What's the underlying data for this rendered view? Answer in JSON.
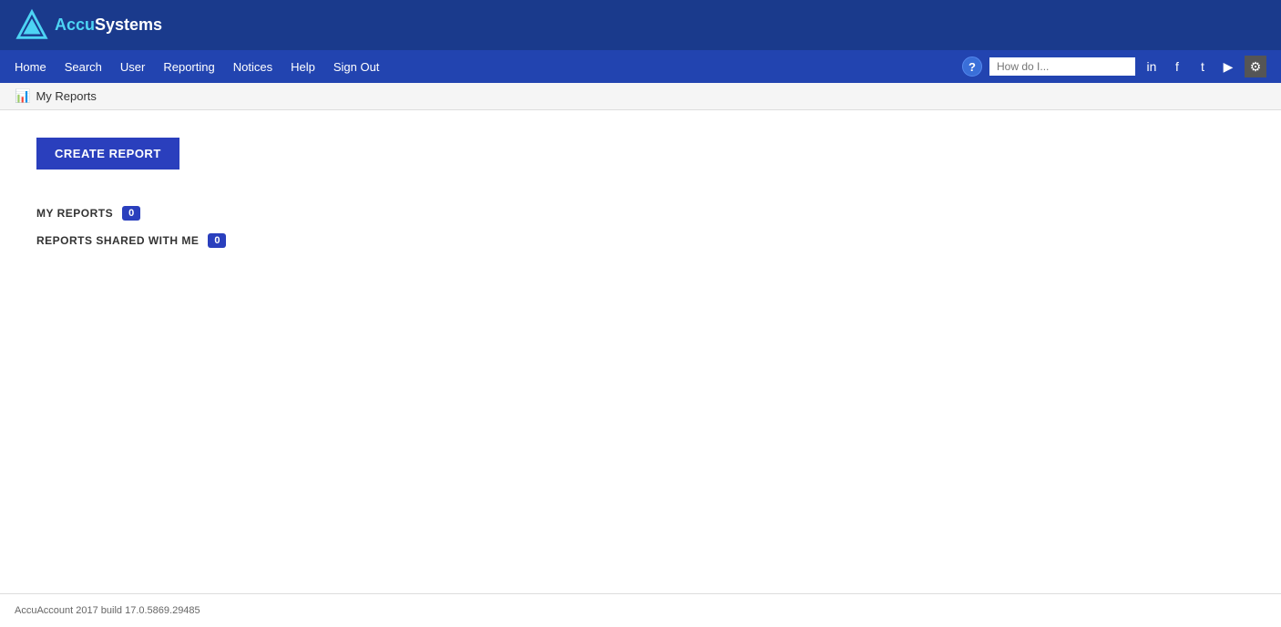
{
  "brand": {
    "logo_accu": "Accu",
    "logo_systems": "Systems"
  },
  "nav": {
    "links": [
      {
        "label": "Home",
        "name": "home"
      },
      {
        "label": "Search",
        "name": "search"
      },
      {
        "label": "User",
        "name": "user"
      },
      {
        "label": "Reporting",
        "name": "reporting"
      },
      {
        "label": "Notices",
        "name": "notices"
      },
      {
        "label": "Help",
        "name": "help"
      },
      {
        "label": "Sign Out",
        "name": "sign-out"
      }
    ],
    "search_placeholder": "How do I..."
  },
  "breadcrumb": {
    "text": "My Reports"
  },
  "main": {
    "create_report_label": "CREATE REPORT",
    "my_reports_label": "MY REPORTS",
    "my_reports_count": "0",
    "shared_reports_label": "REPORTS SHARED WITH ME",
    "shared_reports_count": "0"
  },
  "footer": {
    "text": "AccuAccount 2017 build 17.0.5869.29485"
  },
  "colors": {
    "brand_bar": "#1a3a8c",
    "nav_bar": "#2244b0",
    "button_bg": "#2a3fbd",
    "badge_bg": "#2a3fbd"
  }
}
